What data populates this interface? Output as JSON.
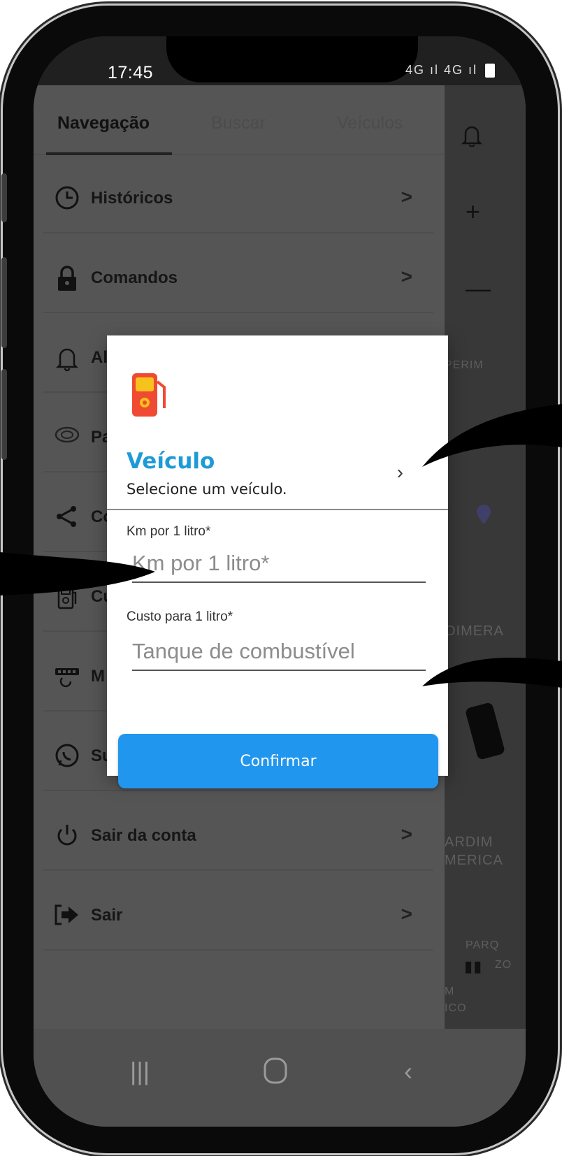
{
  "status_bar": {
    "time": "17:45",
    "icons": "4G ıl 4G ıl"
  },
  "drawer": {
    "tabs": [
      {
        "label": "Navegação"
      },
      {
        "label": "Buscar"
      },
      {
        "label": "Veículos"
      }
    ],
    "items": [
      {
        "label": "Históricos",
        "icon": "clock-icon"
      },
      {
        "label": "Comandos",
        "icon": "lock-icon"
      },
      {
        "label": "Al",
        "icon": "bell-icon"
      },
      {
        "label": "Pa",
        "icon": "odometer-icon"
      },
      {
        "label": "Co",
        "icon": "share-icon"
      },
      {
        "label": "Cu",
        "icon": "fuel-pump-icon"
      },
      {
        "label": "M",
        "icon": "tracker-icon"
      },
      {
        "label": "Suporte",
        "icon": "whatsapp-icon"
      },
      {
        "label": "Sair da conta",
        "icon": "power-icon"
      },
      {
        "label": "Sair",
        "icon": "exit-icon"
      }
    ],
    "chevron": ">"
  },
  "map": {
    "labels": [
      "PERIM",
      "OIMERA",
      "ARDIM",
      "MERICA",
      "PARQ",
      "ZO",
      "M",
      "ICO"
    ]
  },
  "dialog": {
    "vehicle": {
      "title": "Veículo",
      "subtitle": "Selecione um veículo."
    },
    "km_label": "Km por 1 litro*",
    "km_placeholder": "Km por 1 litro*",
    "cost_label": "Custo para 1 litro*",
    "cost_placeholder": "Tanque de combustível",
    "confirm_label": "Confirmar"
  },
  "colors": {
    "accent_blue": "#2196ee",
    "title_blue": "#1e9bd7",
    "fuel_icon_red": "#f04a32",
    "fuel_icon_yellow": "#f8c21d"
  }
}
